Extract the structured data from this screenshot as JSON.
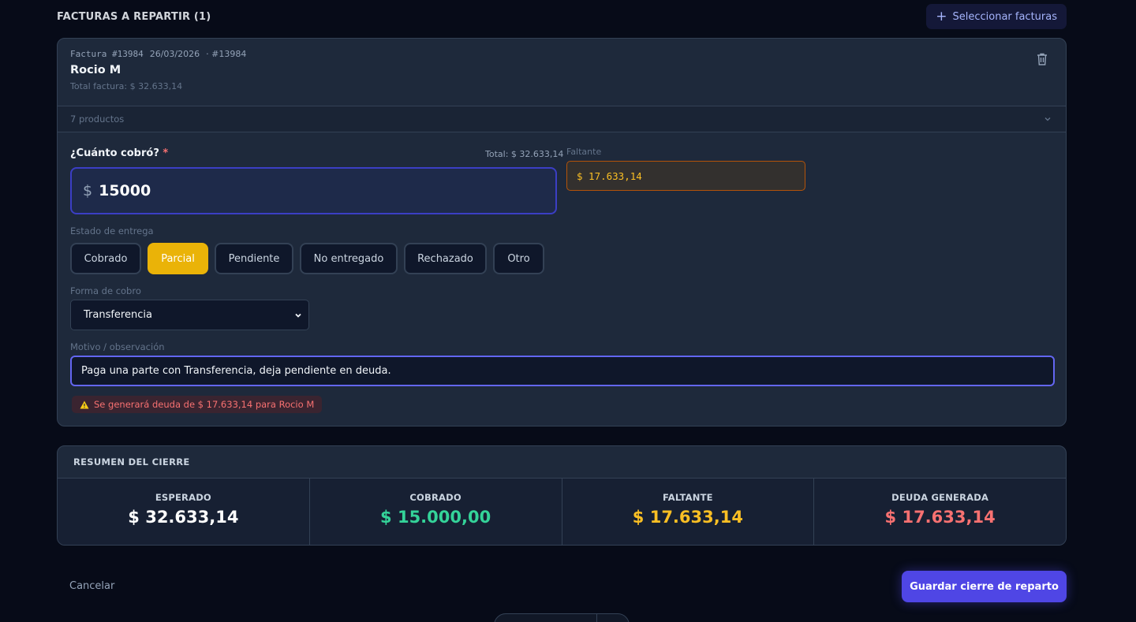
{
  "section": {
    "title": "FACTURAS A REPARTIR (1)",
    "select_button": "Seleccionar facturas",
    "plus_icon": "plus-icon"
  },
  "invoice": {
    "label": "Factura #13984",
    "date": "26/03/2026",
    "ref": "· #13984",
    "client": "Rocio M",
    "total_text": "Total factura: $ 32.633,14",
    "delete_icon": "trash-icon",
    "products_text": "7 productos"
  },
  "form": {
    "cobro_label": "¿Cuánto cobró?",
    "required_mark": "*",
    "total_hint": "Total: $ 32.633,14",
    "currency": "$",
    "amount_value": "15000",
    "faltante_label": "Faltante",
    "faltante_value": "$ 17.633,14",
    "estado_label": "Estado de entrega",
    "estado_options": [
      "Cobrado",
      "Parcial",
      "Pendiente",
      "No entregado",
      "Rechazado",
      "Otro"
    ],
    "estado_selected": "Parcial",
    "forma_label": "Forma de cobro",
    "forma_value": "Transferencia",
    "motivo_label": "Motivo / observación",
    "motivo_value": "Paga una parte con Transferencia, deja pendiente en deuda.",
    "warning_text": "Se generará deuda de $ 17.633,14 para Rocio M"
  },
  "summary": {
    "title": "RESUMEN DEL CIERRE",
    "cells": [
      {
        "caption": "ESPERADO",
        "amount": "$ 32.633,14",
        "color": "#ffffff"
      },
      {
        "caption": "COBRADO",
        "amount": "$ 15.000,00",
        "color": "#34d399"
      },
      {
        "caption": "FALTANTE",
        "amount": "$ 17.633,14",
        "color": "#fbbf24"
      },
      {
        "caption": "DEUDA GENERADA",
        "amount": "$ 17.633,14",
        "color": "#f87171"
      }
    ]
  },
  "footer": {
    "cancel": "Cancelar",
    "save": "Guardar cierre de reparto"
  },
  "colors": {
    "background": "#070b18",
    "card": "#1e293b",
    "accent": "#4f46e5",
    "selected_state": "#eab308",
    "warning": "#f87171"
  }
}
